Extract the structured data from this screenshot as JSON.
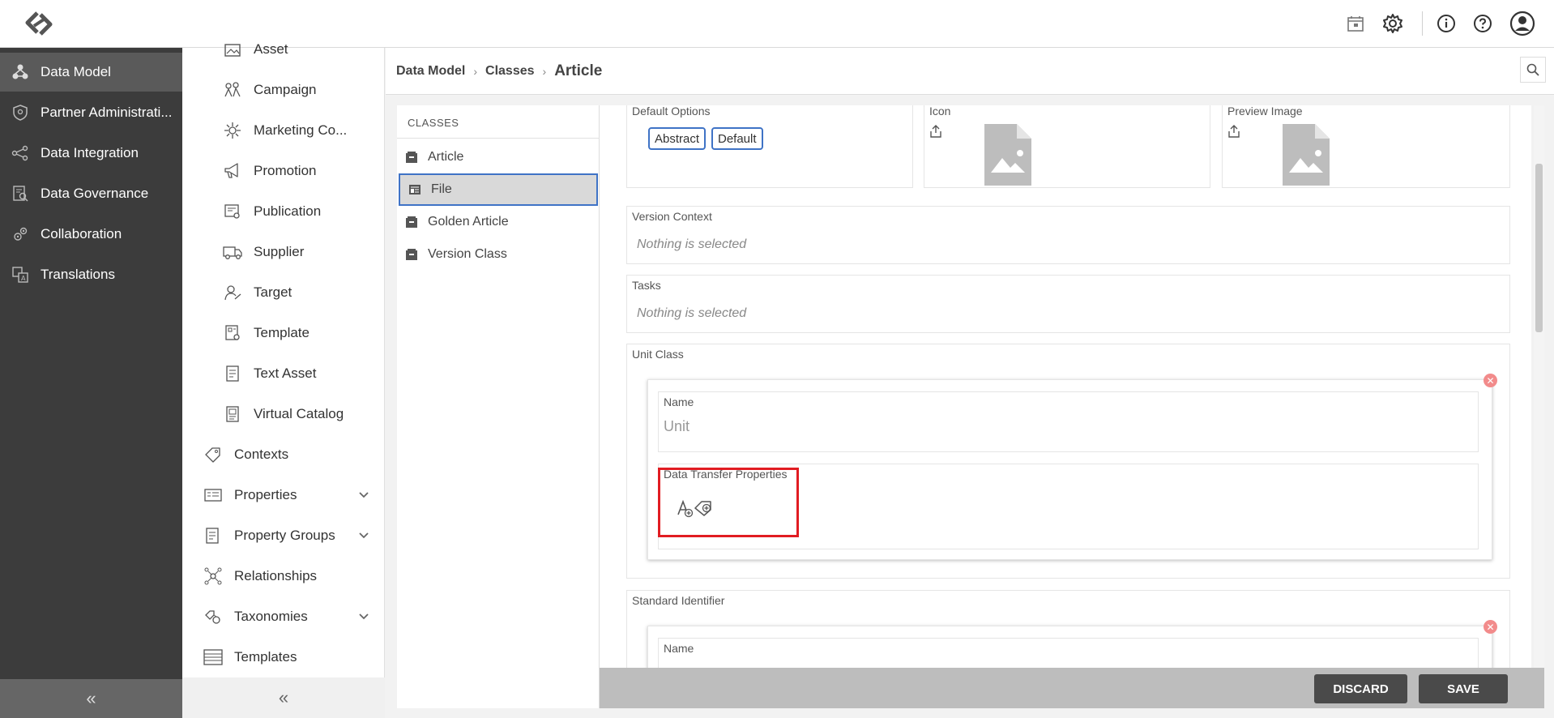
{
  "topbar": {
    "icons": [
      "calendar-icon",
      "gear-icon",
      "info-icon",
      "help-icon",
      "user-icon"
    ]
  },
  "sidebar": {
    "items": [
      {
        "label": "Data Model",
        "icon": "data-model-icon",
        "active": true
      },
      {
        "label": "Partner Administrati...",
        "icon": "shield-icon"
      },
      {
        "label": "Data Integration",
        "icon": "integration-icon"
      },
      {
        "label": "Data Governance",
        "icon": "governance-icon"
      },
      {
        "label": "Collaboration",
        "icon": "collaboration-icon"
      },
      {
        "label": "Translations",
        "icon": "translations-icon"
      }
    ],
    "collapse_label": "«"
  },
  "tree": {
    "items": [
      {
        "label": "Asset",
        "icon": "asset-icon"
      },
      {
        "label": "Campaign",
        "icon": "campaign-icon"
      },
      {
        "label": "Marketing Co...",
        "icon": "marketing-icon"
      },
      {
        "label": "Promotion",
        "icon": "megaphone-icon"
      },
      {
        "label": "Publication",
        "icon": "publication-icon"
      },
      {
        "label": "Supplier",
        "icon": "truck-icon"
      },
      {
        "label": "Target",
        "icon": "target-icon"
      },
      {
        "label": "Template",
        "icon": "template-icon"
      },
      {
        "label": "Text Asset",
        "icon": "text-asset-icon"
      },
      {
        "label": "Virtual Catalog",
        "icon": "catalog-icon"
      },
      {
        "label": "Contexts",
        "icon": "tag-icon"
      },
      {
        "label": "Properties",
        "icon": "properties-icon",
        "expandable": true
      },
      {
        "label": "Property Groups",
        "icon": "property-groups-icon",
        "expandable": true
      },
      {
        "label": "Relationships",
        "icon": "relationships-icon"
      },
      {
        "label": "Taxonomies",
        "icon": "taxonomies-icon",
        "expandable": true
      },
      {
        "label": "Templates",
        "icon": "templates-icon"
      }
    ],
    "collapse_label": "«"
  },
  "breadcrumb": {
    "items": [
      "Data Model",
      "Classes"
    ],
    "current": "Article",
    "sep": "›"
  },
  "classes": {
    "title": "CLASSES",
    "items": [
      "Article",
      "File",
      "Golden Article",
      "Version Class"
    ],
    "active": "File"
  },
  "detail": {
    "default_options": {
      "label": "Default Options",
      "chips": [
        "Abstract",
        "Default"
      ]
    },
    "icon_field": {
      "label": "Icon"
    },
    "preview_image": {
      "label": "Preview Image"
    },
    "version_context": {
      "label": "Version Context",
      "value": "Nothing is selected"
    },
    "tasks": {
      "label": "Tasks",
      "value": "Nothing is selected"
    },
    "unit_class": {
      "label": "Unit Class",
      "name_label": "Name",
      "name_value": "Unit",
      "dtp_label": "Data Transfer Properties"
    },
    "standard_identifier": {
      "label": "Standard Identifier",
      "name_label": "Name"
    }
  },
  "footer": {
    "discard": "DISCARD",
    "save": "SAVE"
  }
}
